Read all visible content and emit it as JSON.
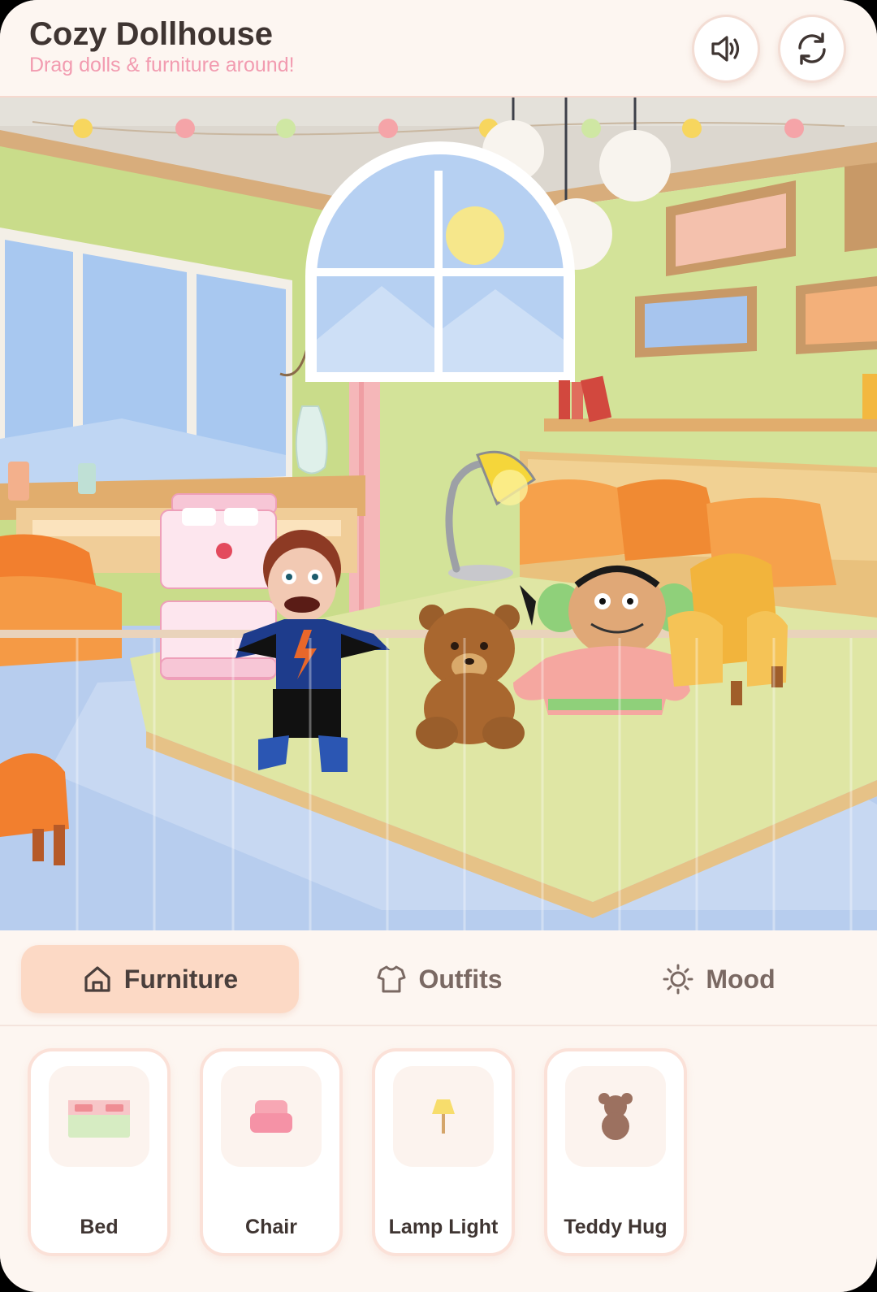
{
  "header": {
    "title": "Cozy Dollhouse",
    "subtitle": "Drag dolls & furniture around!"
  },
  "icons": {
    "sound": "speaker-volume-icon",
    "reset": "refresh-arrows-icon",
    "furniture_tab": "home-icon",
    "outfits_tab": "shirt-icon",
    "mood_tab": "sun-icon"
  },
  "tabs": [
    {
      "label": "Furniture",
      "active": true
    },
    {
      "label": "Outfits",
      "active": false
    },
    {
      "label": "Mood",
      "active": false
    }
  ],
  "items": [
    {
      "label": "Bed",
      "icon": "bed-icon"
    },
    {
      "label": "Chair",
      "icon": "chair-icon"
    },
    {
      "label": "Lamp Light",
      "icon": "lamp-icon"
    },
    {
      "label": "Teddy Hug",
      "icon": "teddy-bear-icon"
    }
  ],
  "colors": {
    "accent": "#fcd9c5",
    "subtitle": "#f29bb0",
    "background": "#fdf6f1",
    "wall": "#cfe197",
    "floor": "#b7cdee"
  }
}
